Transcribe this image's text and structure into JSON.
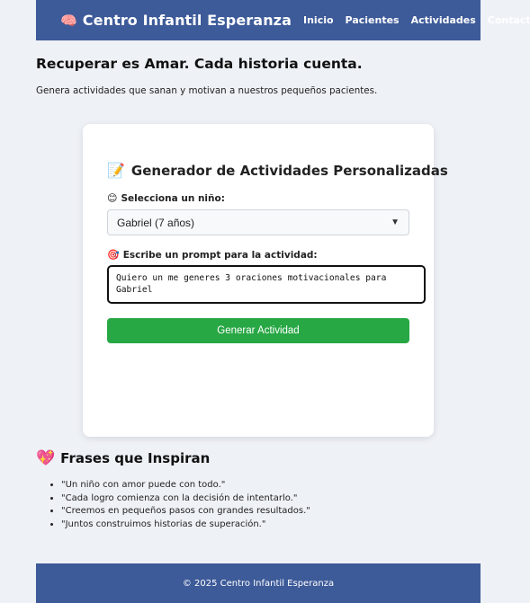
{
  "header": {
    "brand_icon": "🧠",
    "brand": "Centro Infantil Esperanza",
    "nav": [
      "Inicio",
      "Pacientes",
      "Actividades",
      "Contacto"
    ]
  },
  "hero": {
    "title": "Recuperar es Amar. Cada historia cuenta.",
    "subtitle": "Genera actividades que sanan y motivan a nuestros pequeños pacientes."
  },
  "generator": {
    "title_icon": "📝",
    "title": "Generador de Actividades Personalizadas",
    "child_icon": "😊",
    "child_label": "Selecciona un niño:",
    "child_selected": "Gabriel (7 años)",
    "prompt_icon": "🎯",
    "prompt_label": "Escribe un prompt para la actividad:",
    "prompt_value": "Quiero un me generes 3 oraciones motivacionales para Gabriel",
    "button_label": "Generar Actividad"
  },
  "quotes": {
    "icon": "💖",
    "title": "Frases que Inspiran",
    "items": [
      "\"Un niño con amor puede con todo.\"",
      "\"Cada logro comienza con la decisión de intentarlo.\"",
      "\"Creemos en pequeños pasos con grandes resultados.\"",
      "\"Juntos construimos historias de superación.\""
    ]
  },
  "footer": {
    "text": "© 2025 Centro Infantil Esperanza"
  },
  "colors": {
    "header_bg": "#3d5a99",
    "page_bg": "#eef1f6",
    "button_bg": "#28a745"
  }
}
